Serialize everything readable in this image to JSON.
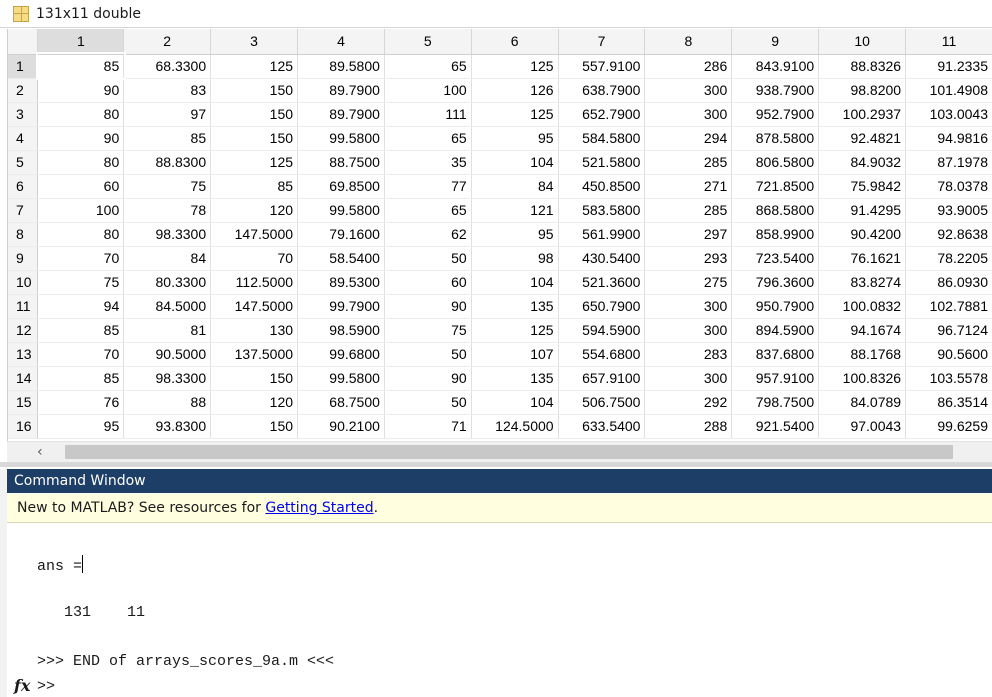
{
  "variable": {
    "title": "131x11 double",
    "icon": "variable-matrix-icon"
  },
  "grid": {
    "columns": [
      "1",
      "2",
      "3",
      "4",
      "5",
      "6",
      "7",
      "8",
      "9",
      "10",
      "11"
    ],
    "rows": [
      {
        "label": "1",
        "cells": [
          "85",
          "68.3300",
          "125",
          "89.5800",
          "65",
          "125",
          "557.9100",
          "286",
          "843.9100",
          "88.8326",
          "91.2335"
        ]
      },
      {
        "label": "2",
        "cells": [
          "90",
          "83",
          "150",
          "89.7900",
          "100",
          "126",
          "638.7900",
          "300",
          "938.7900",
          "98.8200",
          "101.4908"
        ]
      },
      {
        "label": "3",
        "cells": [
          "80",
          "97",
          "150",
          "89.7900",
          "111",
          "125",
          "652.7900",
          "300",
          "952.7900",
          "100.2937",
          "103.0043"
        ]
      },
      {
        "label": "4",
        "cells": [
          "90",
          "85",
          "150",
          "99.5800",
          "65",
          "95",
          "584.5800",
          "294",
          "878.5800",
          "92.4821",
          "94.9816"
        ]
      },
      {
        "label": "5",
        "cells": [
          "80",
          "88.8300",
          "125",
          "88.7500",
          "35",
          "104",
          "521.5800",
          "285",
          "806.5800",
          "84.9032",
          "87.1978"
        ]
      },
      {
        "label": "6",
        "cells": [
          "60",
          "75",
          "85",
          "69.8500",
          "77",
          "84",
          "450.8500",
          "271",
          "721.8500",
          "75.9842",
          "78.0378"
        ]
      },
      {
        "label": "7",
        "cells": [
          "100",
          "78",
          "120",
          "99.5800",
          "65",
          "121",
          "583.5800",
          "285",
          "868.5800",
          "91.4295",
          "93.9005"
        ]
      },
      {
        "label": "8",
        "cells": [
          "80",
          "98.3300",
          "147.5000",
          "79.1600",
          "62",
          "95",
          "561.9900",
          "297",
          "858.9900",
          "90.4200",
          "92.8638"
        ]
      },
      {
        "label": "9",
        "cells": [
          "70",
          "84",
          "70",
          "58.5400",
          "50",
          "98",
          "430.5400",
          "293",
          "723.5400",
          "76.1621",
          "78.2205"
        ]
      },
      {
        "label": "10",
        "cells": [
          "75",
          "80.3300",
          "112.5000",
          "89.5300",
          "60",
          "104",
          "521.3600",
          "275",
          "796.3600",
          "83.8274",
          "86.0930"
        ]
      },
      {
        "label": "11",
        "cells": [
          "94",
          "84.5000",
          "147.5000",
          "99.7900",
          "90",
          "135",
          "650.7900",
          "300",
          "950.7900",
          "100.0832",
          "102.7881"
        ]
      },
      {
        "label": "12",
        "cells": [
          "85",
          "81",
          "130",
          "98.5900",
          "75",
          "125",
          "594.5900",
          "300",
          "894.5900",
          "94.1674",
          "96.7124"
        ]
      },
      {
        "label": "13",
        "cells": [
          "70",
          "90.5000",
          "137.5000",
          "99.6800",
          "50",
          "107",
          "554.6800",
          "283",
          "837.6800",
          "88.1768",
          "90.5600"
        ]
      },
      {
        "label": "14",
        "cells": [
          "85",
          "98.3300",
          "150",
          "99.5800",
          "90",
          "135",
          "657.9100",
          "300",
          "957.9100",
          "100.8326",
          "103.5578"
        ]
      },
      {
        "label": "15",
        "cells": [
          "76",
          "88",
          "120",
          "68.7500",
          "50",
          "104",
          "506.7500",
          "292",
          "798.7500",
          "84.0789",
          "86.3514"
        ]
      },
      {
        "label": "16",
        "cells": [
          "95",
          "93.8300",
          "150",
          "90.2100",
          "71",
          "124.5000",
          "633.5400",
          "288",
          "921.5400",
          "97.0043",
          "99.6259"
        ]
      }
    ]
  },
  "command_window": {
    "title": "Command Window",
    "banner_text": "New to MATLAB? See resources for ",
    "banner_link": "Getting Started",
    "banner_suffix": ".",
    "ans_line": "ans =",
    "result_line": "   131    11",
    "end_line": ">>> END of arrays_scores_9a.m <<<",
    "prompt": ">>",
    "fx_label": "fx"
  },
  "colors": {
    "title_bar": "#1d3f67",
    "banner": "#ffffe0",
    "link": "#0000ee"
  }
}
